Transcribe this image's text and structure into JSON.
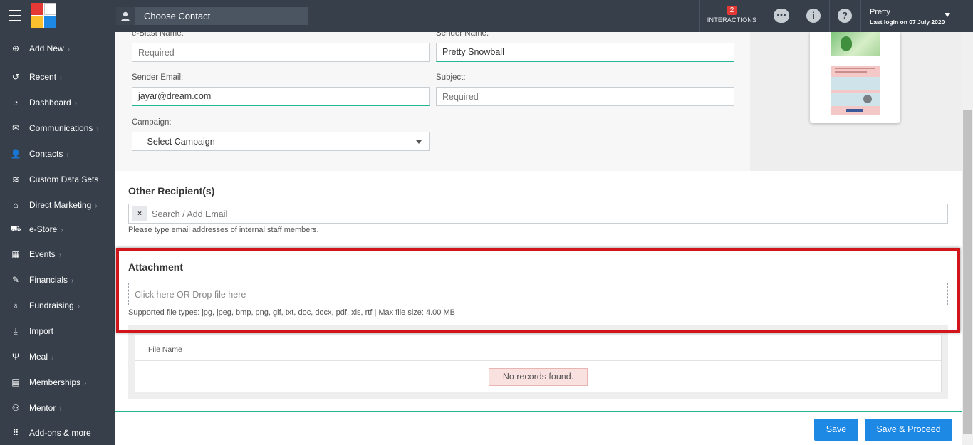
{
  "header": {
    "choose_contact": "Choose Contact",
    "interactions_count": "2",
    "interactions_label": "INTERACTIONS",
    "user_name": "Pretty",
    "last_login": "Last login on 07 July 2020"
  },
  "sidebar": {
    "items": [
      {
        "label": "Add New",
        "icon": "plus-circle-icon",
        "glyph": "⊕",
        "chevron": true
      },
      {
        "label": "Recent",
        "icon": "history-icon",
        "glyph": "↺",
        "chevron": true
      },
      {
        "label": "Dashboard",
        "icon": "dashboard-icon",
        "glyph": "◔",
        "chevron": true
      },
      {
        "label": "Communications",
        "icon": "envelope-icon",
        "glyph": "✉",
        "chevron": true
      },
      {
        "label": "Contacts",
        "icon": "user-icon",
        "glyph": "👤",
        "chevron": true
      },
      {
        "label": "Custom Data Sets",
        "icon": "layers-icon",
        "glyph": "≋",
        "chevron": false
      },
      {
        "label": "Direct Marketing",
        "icon": "bank-icon",
        "glyph": "⌂",
        "chevron": true
      },
      {
        "label": "e-Store",
        "icon": "cart-icon",
        "glyph": "⛟",
        "chevron": true
      },
      {
        "label": "Events",
        "icon": "calendar-icon",
        "glyph": "▦",
        "chevron": true
      },
      {
        "label": "Financials",
        "icon": "money-icon",
        "glyph": "✎",
        "chevron": true
      },
      {
        "label": "Fundraising",
        "icon": "moneybag-icon",
        "glyph": "♁",
        "chevron": true
      },
      {
        "label": "Import",
        "icon": "import-icon",
        "glyph": "⤓",
        "chevron": false
      },
      {
        "label": "Meal",
        "icon": "cutlery-icon",
        "glyph": "Ψ",
        "chevron": true
      },
      {
        "label": "Memberships",
        "icon": "id-card-icon",
        "glyph": "▤",
        "chevron": true
      },
      {
        "label": "Mentor",
        "icon": "mentor-icon",
        "glyph": "⚇",
        "chevron": true
      },
      {
        "label": "Add-ons & more",
        "icon": "grid-icon",
        "glyph": "⠿",
        "chevron": false
      }
    ]
  },
  "form": {
    "eblast_label": "e-Blast Name:",
    "eblast_placeholder": "Required",
    "sender_name_label": "Sender Name:",
    "sender_name_value": "Pretty Snowball",
    "sender_email_label": "Sender Email:",
    "sender_email_value": "jayar@dream.com",
    "subject_label": "Subject:",
    "subject_placeholder": "Required",
    "campaign_label": "Campaign:",
    "campaign_value": "---Select Campaign---"
  },
  "recipients": {
    "title": "Other Recipient(s)",
    "chip_close": "×",
    "placeholder": "Search / Add Email",
    "helper": "Please type email addresses of internal staff members."
  },
  "attachment": {
    "title": "Attachment",
    "drop_text": "Click here OR Drop file here",
    "supported": "Supported file types: jpg, jpeg, bmp, png, gif, txt, doc, docx, pdf, xls, rtf | Max file size: 4.00 MB",
    "column_file_name": "File Name",
    "no_records": "No records found."
  },
  "footer": {
    "save": "Save",
    "save_proceed": "Save & Proceed"
  },
  "colors": {
    "accent": "#25b596",
    "primary_button": "#1e88e5",
    "highlight": "#d0161b",
    "topbar": "#363f4a"
  }
}
